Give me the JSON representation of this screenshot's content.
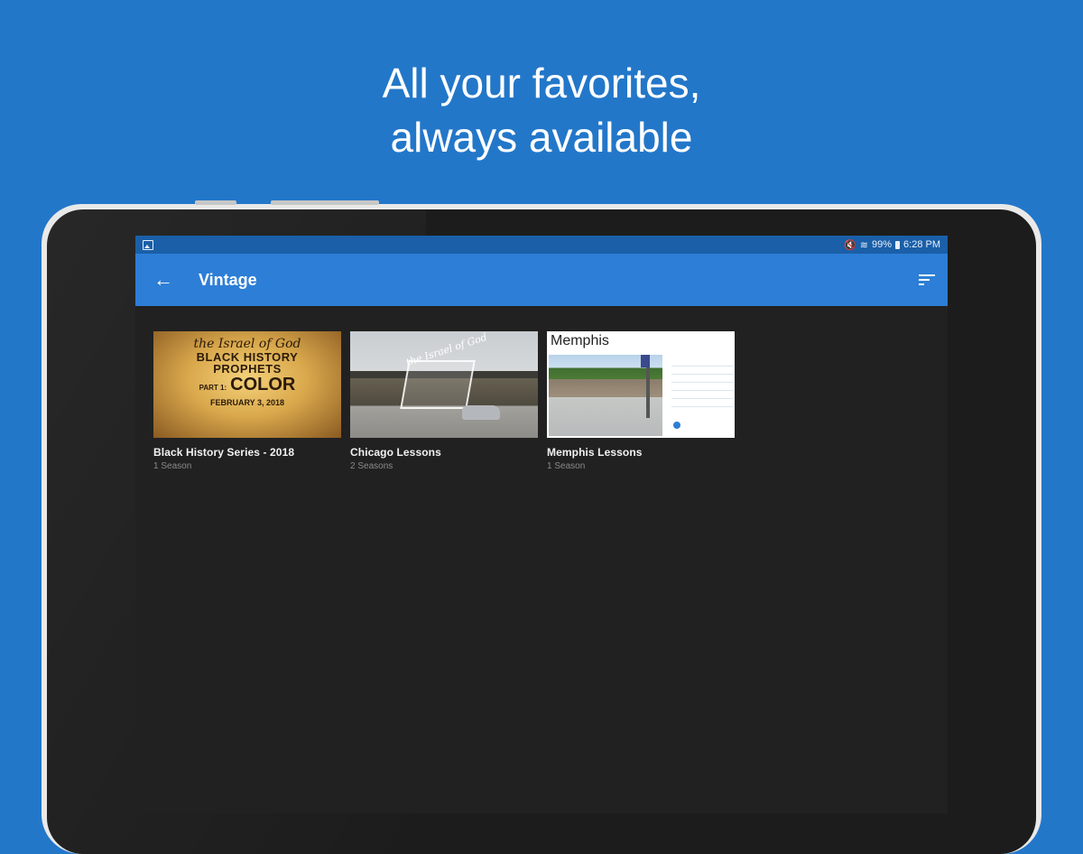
{
  "headline": {
    "line1": "All your favorites,",
    "line2": "always available"
  },
  "status_bar": {
    "battery": "99%",
    "time": "6:28 PM"
  },
  "app_bar": {
    "title": "Vintage"
  },
  "items": [
    {
      "title": "Black History Series - 2018",
      "subtitle": "1 Season",
      "thumb": {
        "script": "the Israel of God",
        "heading": "BLACK HISTORY",
        "subheading": "PROPHETS",
        "part": "PART 1:",
        "main": "COLOR",
        "date": "FEBRUARY 3, 2018"
      }
    },
    {
      "title": "Chicago Lessons",
      "subtitle": "2 Seasons",
      "thumb": {
        "script": "the Israel of God"
      }
    },
    {
      "title": "Memphis Lessons",
      "subtitle": "1 Season",
      "thumb": {
        "heading": "Memphis"
      }
    }
  ],
  "colors": {
    "background": "#2377c9",
    "app_bar": "#2d7ed6",
    "status_bar": "#1a5fa8",
    "screen": "#212121"
  },
  "icons": [
    "image-icon",
    "mute-icon",
    "wifi-icon",
    "battery-icon",
    "back-arrow-icon",
    "sort-icon"
  ]
}
